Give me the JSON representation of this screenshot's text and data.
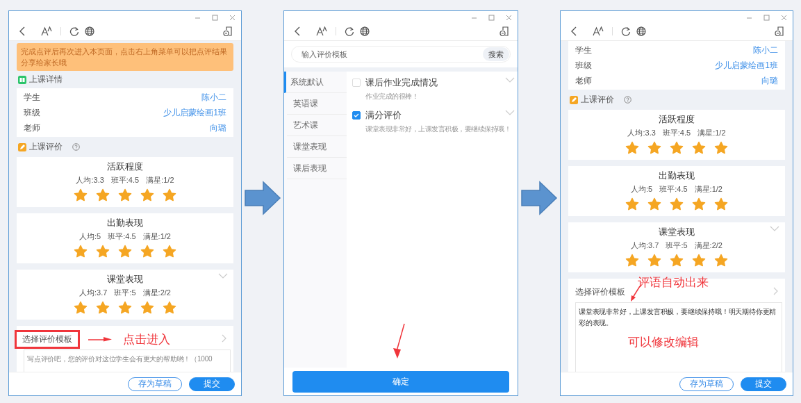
{
  "windows": [
    {
      "kind": "form",
      "notice": "完成点评后再次进入本页面，点击右上角菜单可以把点评结果分享给家长哦",
      "details_title": "上课详情",
      "details": [
        {
          "label": "学生",
          "value": "陈小二"
        },
        {
          "label": "班级",
          "value": "少儿启蒙绘画1班"
        },
        {
          "label": "老师",
          "value": "向璐"
        }
      ],
      "rating_title": "上课评价",
      "ratings": [
        {
          "title": "活跃程度",
          "stats": [
            "人均:3.3",
            "班平:4.5",
            "满星:1/2"
          ],
          "stars": 5,
          "collapsible": false
        },
        {
          "title": "出勤表现",
          "stats": [
            "人均:5",
            "班平:4.5",
            "满星:1/2"
          ],
          "stars": 5,
          "collapsible": false
        },
        {
          "title": "课堂表现",
          "stats": [
            "人均:3.7",
            "班平:5",
            "满星:2/2"
          ],
          "stars": 5,
          "collapsible": true
        }
      ],
      "template": {
        "label": "选择评价模板",
        "highlighted": true,
        "callout": "点击进入"
      },
      "comment": {
        "placeholder": "写点评价吧，您的评价对这位学生会有更大的帮助哟！（1000"
      },
      "buttons": [
        {
          "label": "存为草稿",
          "kind": "outline"
        },
        {
          "label": "提交",
          "kind": "primary"
        }
      ]
    },
    {
      "kind": "picker",
      "search": {
        "placeholder": "输入评价模板",
        "button": "搜索"
      },
      "categories": [
        {
          "label": "系统默认",
          "selected": true
        },
        {
          "label": "英语课",
          "selected": false
        },
        {
          "label": "艺术课",
          "selected": false
        },
        {
          "label": "课堂表现",
          "selected": false
        },
        {
          "label": "课后表现",
          "selected": false
        }
      ],
      "templates": [
        {
          "title": "课后作业完成情况",
          "text": "作业完成的很棒！",
          "checked": false
        },
        {
          "title": "满分评价",
          "text": "课堂表现非常好，上课发言积极，要继续保持哦！",
          "checked": true
        }
      ],
      "confirm": {
        "label": "确定",
        "pointer": true
      }
    },
    {
      "kind": "form",
      "details": [
        {
          "label": "学生",
          "value": "陈小二"
        },
        {
          "label": "班级",
          "value": "少儿启蒙绘画1班"
        },
        {
          "label": "老师",
          "value": "向璐"
        }
      ],
      "rating_title": "上课评价",
      "ratings": [
        {
          "title": "活跃程度",
          "stats": [
            "人均:3.3",
            "班平:4.5",
            "满星:1/2"
          ],
          "stars": 5,
          "collapsible": false
        },
        {
          "title": "出勤表现",
          "stats": [
            "人均:5",
            "班平:4.5",
            "满星:1/2"
          ],
          "stars": 5,
          "collapsible": false
        },
        {
          "title": "课堂表现",
          "stats": [
            "人均:3.7",
            "班平:5",
            "满星:2/2"
          ],
          "stars": 5,
          "collapsible": true
        }
      ],
      "template": {
        "label": "选择评价模板",
        "highlighted": false,
        "callout": "评语自动出来"
      },
      "comment": {
        "value": "课堂表现非常好，上课发言积极，要继续保持哦！明天期待你更精彩的表现。",
        "note": "可以修改编辑"
      },
      "buttons": [
        {
          "label": "存为草稿",
          "kind": "outline"
        },
        {
          "label": "提交",
          "kind": "primary"
        }
      ]
    }
  ]
}
